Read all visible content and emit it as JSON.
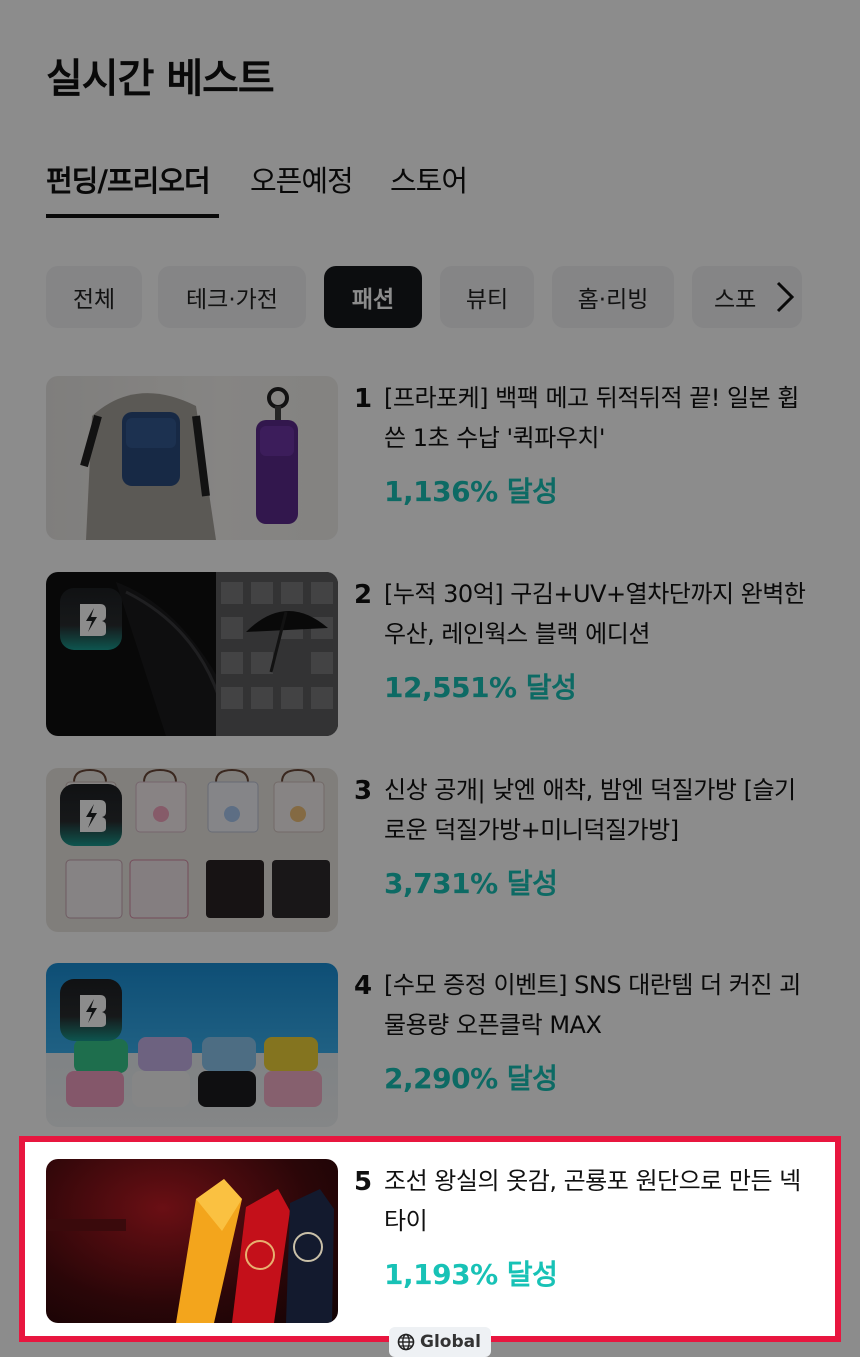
{
  "page": {
    "title": "실시간 베스트"
  },
  "tabs": [
    {
      "label": "펀딩/프리오더",
      "active": true
    },
    {
      "label": "오픈예정",
      "active": false
    },
    {
      "label": "스토어",
      "active": false
    }
  ],
  "categories": [
    {
      "label": "전체",
      "active": false
    },
    {
      "label": "테크·가전",
      "active": false
    },
    {
      "label": "패션",
      "active": true
    },
    {
      "label": "뷰티",
      "active": false
    },
    {
      "label": "홈·리빙",
      "active": false
    },
    {
      "label": "스포",
      "active": false
    }
  ],
  "items": [
    {
      "rank": "1",
      "title": "[프라포케] 백팩 메고 뒤적뒤적 끝! 일본 휩쓴 1초 수납 '퀵파우치'",
      "achievement": "1,136% 달성"
    },
    {
      "rank": "2",
      "title": "[누적 30억] 구김+UV+열차단까지 완벽한 우산, 레인웍스 블랙 에디션",
      "achievement": "12,551% 달성"
    },
    {
      "rank": "3",
      "title": "신상 공개| 낮엔 애착, 밤엔 덕질가방 [슬기로운 덕질가방+미니덕질가방]",
      "achievement": "3,731% 달성"
    },
    {
      "rank": "4",
      "title": "[수모 증정 이벤트] SNS 대란템 더 커진 괴물용량 오픈클락 MAX",
      "achievement": "2,290% 달성"
    },
    {
      "rank": "5",
      "title": "조선 왕실의 옷감, 곤룡포 원단으로 만든 넥타이",
      "achievement": "1,193% 달성",
      "tag": "Global"
    }
  ],
  "colors": {
    "accent": "#18c2b6",
    "highlight_border": "#e8163f",
    "dim_overlay": "rgba(0,0,0,0.45)"
  },
  "icons": {
    "next": "chevron-right-icon",
    "badge": "lightning-badge-icon",
    "global": "globe-icon"
  }
}
